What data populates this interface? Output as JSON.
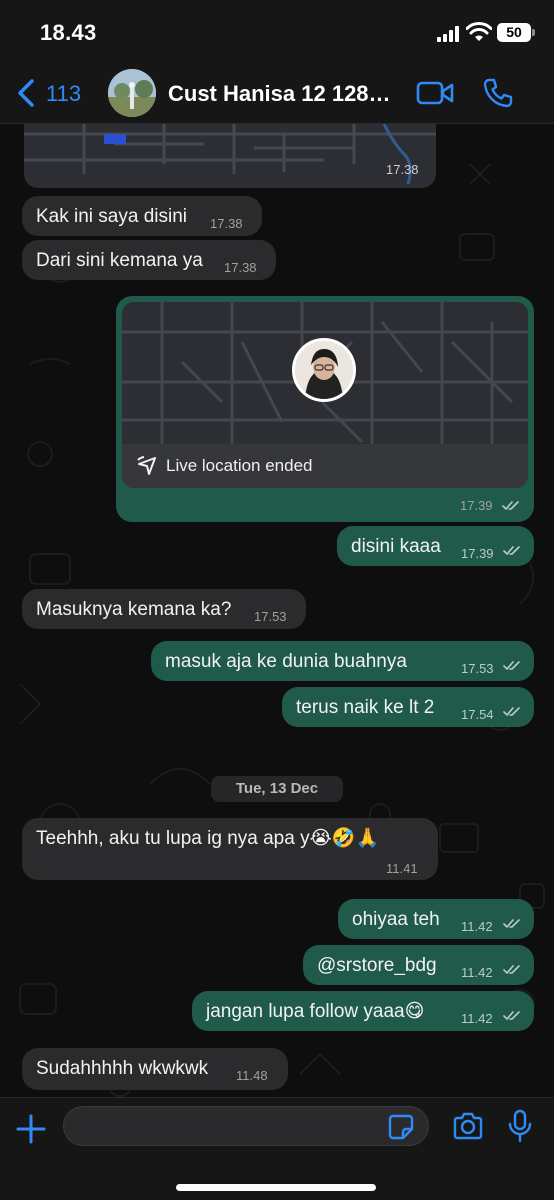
{
  "status_bar": {
    "time": "18.43",
    "battery": "50"
  },
  "header": {
    "back_count": "113",
    "contact_name": "Cust Hanisa 12 128g..."
  },
  "messages": [
    {
      "id": "m0",
      "type": "map-partial",
      "direction": "in",
      "time": "17.38"
    },
    {
      "id": "m1",
      "direction": "in",
      "text": "Kak ini saya disini",
      "time": "17.38"
    },
    {
      "id": "m2",
      "direction": "in",
      "text": "Dari sini kemana ya",
      "time": "17.38"
    },
    {
      "id": "m3",
      "type": "live-location",
      "direction": "out",
      "label": "Live location ended",
      "time": "17.39",
      "status": "read"
    },
    {
      "id": "m4",
      "direction": "out",
      "text": "disini kaaa",
      "time": "17.39",
      "status": "read"
    },
    {
      "id": "m5",
      "direction": "in",
      "text": "Masuknya kemana ka?",
      "time": "17.53"
    },
    {
      "id": "m6",
      "direction": "out",
      "text": "masuk aja ke dunia buahnya",
      "time": "17.53",
      "status": "read"
    },
    {
      "id": "m7",
      "direction": "out",
      "text": "terus naik ke lt 2",
      "time": "17.54",
      "status": "read"
    },
    {
      "id": "m8",
      "direction": "in",
      "text": "Teehhh, aku tu lupa ig nya apa y😭🤣🙏",
      "time": "11.41"
    },
    {
      "id": "m9",
      "direction": "out",
      "text": "ohiyaa teh",
      "time": "11.42",
      "status": "read"
    },
    {
      "id": "m10",
      "direction": "out",
      "text": "@srstore_bdg",
      "time": "11.42",
      "status": "read"
    },
    {
      "id": "m11",
      "direction": "out",
      "text": "jangan lupa follow yaaa😋",
      "time": "11.42",
      "status": "read"
    },
    {
      "id": "m12",
      "direction": "in",
      "text": "Sudahhhhh wkwkwk",
      "time": "11.48"
    }
  ],
  "date_separator": "Tue, 13 Dec",
  "composer": {
    "placeholder": ""
  },
  "colors": {
    "accent": "#2f8af5",
    "outgoing_bubble": "#1f5a4a",
    "incoming_bubble": "#2b2b2d",
    "background": "#0e0e0e"
  },
  "icons": {
    "back": "chevron-left-icon",
    "video": "video-camera-icon",
    "phone": "phone-icon",
    "add": "plus-icon",
    "sticker": "sticker-icon",
    "camera": "camera-icon",
    "mic": "microphone-icon",
    "live_location": "location-arrow-icon",
    "read": "double-check-icon"
  }
}
